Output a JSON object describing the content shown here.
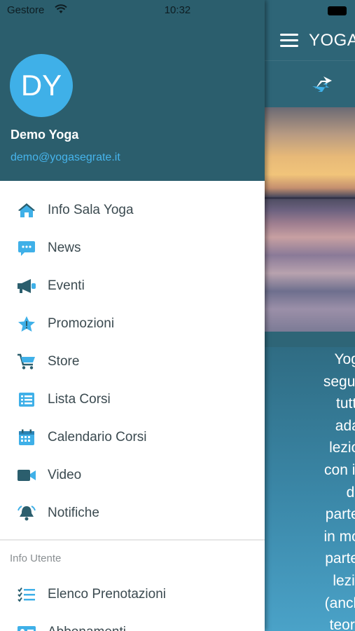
{
  "status_bar": {
    "carrier": "Gestore",
    "time": "10:32"
  },
  "user": {
    "initials": "DY",
    "name": "Demo Yoga",
    "email": "demo@yogasegrate.it"
  },
  "menu": [
    {
      "label": "Info Sala Yoga",
      "icon": "home-icon"
    },
    {
      "label": "News",
      "icon": "chat-icon"
    },
    {
      "label": "Eventi",
      "icon": "megaphone-icon"
    },
    {
      "label": "Promozioni",
      "icon": "star-badge-icon"
    },
    {
      "label": "Store",
      "icon": "cart-icon"
    },
    {
      "label": "Lista Corsi",
      "icon": "list-icon"
    },
    {
      "label": "Calendario Corsi",
      "icon": "calendar-icon"
    },
    {
      "label": "Video",
      "icon": "video-camera-icon"
    },
    {
      "label": "Notifiche",
      "icon": "bell-icon"
    }
  ],
  "user_section": {
    "title": "Info Utente",
    "items": [
      {
        "label": "Elenco Prenotazioni",
        "icon": "checklist-icon"
      },
      {
        "label": "Abbonamenti",
        "icon": "id-card-icon"
      }
    ]
  },
  "main": {
    "title": "YOGA",
    "text_lines": [
      "YogaS",
      "seguendo",
      "tutti la",
      "adatto",
      "lezioni s",
      "con inseg",
      "div",
      "partecipa",
      "in modo c",
      "parte di a",
      "lezioni,",
      "(anche re",
      "teoria ai"
    ]
  },
  "colors": {
    "header_bg": "#2b5e6d",
    "accent": "#3fb0e8",
    "email": "#46b4ec"
  }
}
